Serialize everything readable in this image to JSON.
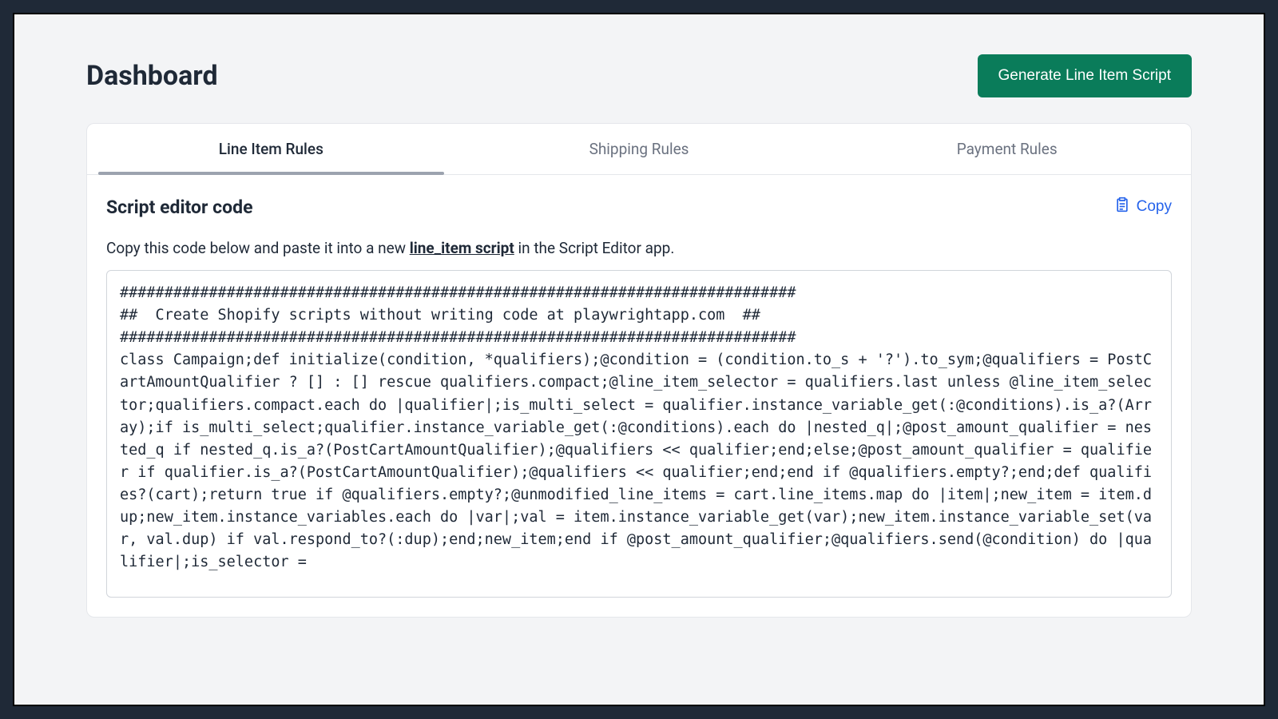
{
  "header": {
    "title": "Dashboard",
    "generate_button_label": "Generate Line Item Script"
  },
  "tabs": [
    {
      "label": "Line Item Rules",
      "active": true
    },
    {
      "label": "Shipping Rules",
      "active": false
    },
    {
      "label": "Payment Rules",
      "active": false
    }
  ],
  "section": {
    "title": "Script editor code",
    "copy_label": "Copy",
    "description_prefix": "Copy this code below and paste it into a new ",
    "description_link": "line_item script",
    "description_suffix": " in the Script Editor app."
  },
  "code": "############################################################################\n##  Create Shopify scripts without writing code at playwrightapp.com  ##\n############################################################################\nclass Campaign;def initialize(condition, *qualifiers);@condition = (condition.to_s + '?').to_sym;@qualifiers = PostCartAmountQualifier ? [] : [] rescue qualifiers.compact;@line_item_selector = qualifiers.last unless @line_item_selector;qualifiers.compact.each do |qualifier|;is_multi_select = qualifier.instance_variable_get(:@conditions).is_a?(Array);if is_multi_select;qualifier.instance_variable_get(:@conditions).each do |nested_q|;@post_amount_qualifier = nested_q if nested_q.is_a?(PostCartAmountQualifier);@qualifiers << qualifier;end;else;@post_amount_qualifier = qualifier if qualifier.is_a?(PostCartAmountQualifier);@qualifiers << qualifier;end;end if @qualifiers.empty?;end;def qualifies?(cart);return true if @qualifiers.empty?;@unmodified_line_items = cart.line_items.map do |item|;new_item = item.dup;new_item.instance_variables.each do |var|;val = item.instance_variable_get(var);new_item.instance_variable_set(var, val.dup) if val.respond_to?(:dup);end;new_item;end if @post_amount_qualifier;@qualifiers.send(@condition) do |qualifier|;is_selector ="
}
